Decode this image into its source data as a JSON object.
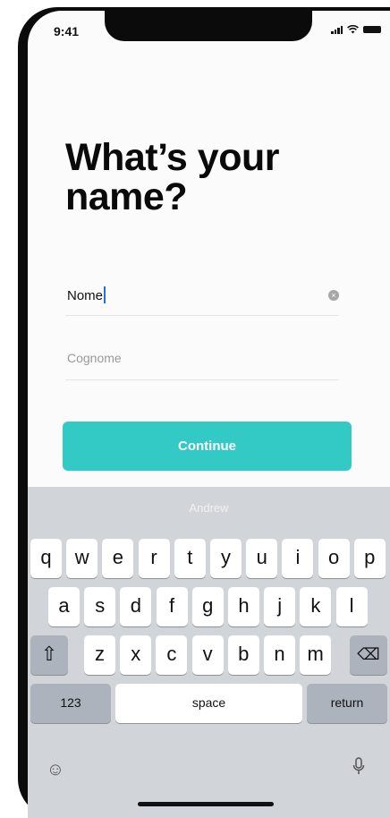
{
  "status_bar": {
    "time": "9:41"
  },
  "title": "What’s your name?",
  "form": {
    "first_name_value": "Nome",
    "last_name_placeholder": "Cognome",
    "clear_glyph": "×"
  },
  "continue_label": "Continue",
  "keyboard": {
    "suggestion": "Andrew",
    "row1": [
      "q",
      "w",
      "e",
      "r",
      "t",
      "y",
      "u",
      "i",
      "o",
      "p"
    ],
    "row2": [
      "a",
      "s",
      "d",
      "f",
      "g",
      "h",
      "j",
      "k",
      "l"
    ],
    "row3": [
      "z",
      "x",
      "c",
      "v",
      "b",
      "n",
      "m"
    ],
    "shift_glyph": "⇧",
    "delete_glyph": "⌫",
    "numbers_label": "123",
    "space_label": "space",
    "return_label": "return",
    "emoji_glyph": "☺",
    "mic_glyph": "🎙"
  },
  "colors": {
    "accent": "#33c9c5",
    "keyboard_bg": "#d1d4d9",
    "cursor": "#2d6cdf"
  }
}
